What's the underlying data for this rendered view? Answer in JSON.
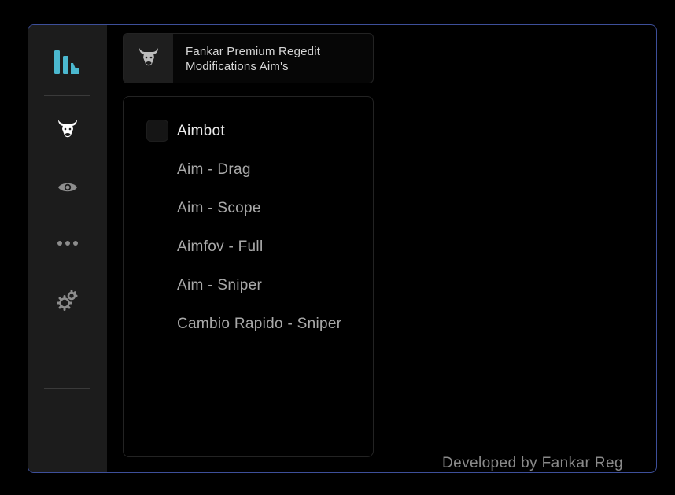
{
  "app": {
    "logo_icon": "app-logo-icon",
    "accent_color": "#4bb8cf",
    "border_color": "#3d4f9a"
  },
  "sidebar": {
    "items": [
      {
        "icon": "bull-icon",
        "active": true
      },
      {
        "icon": "eye-icon",
        "active": false
      },
      {
        "icon": "more-dots-icon",
        "active": false
      },
      {
        "icon": "gears-icon",
        "active": false
      }
    ]
  },
  "header": {
    "icon": "bull-icon",
    "title_line1": "Fankar Premium Regedit",
    "title_line2": "Modifications Aim's"
  },
  "options": [
    {
      "label": "Aimbot",
      "has_checkbox": true
    },
    {
      "label": "Aim - Drag",
      "has_checkbox": false
    },
    {
      "label": "Aim - Scope",
      "has_checkbox": false
    },
    {
      "label": "Aimfov - Full",
      "has_checkbox": false
    },
    {
      "label": "Aim - Sniper",
      "has_checkbox": false
    },
    {
      "label": "Cambio Rapido - Sniper",
      "has_checkbox": false
    }
  ],
  "footer": {
    "text": "Developed by Fankar Reg"
  }
}
